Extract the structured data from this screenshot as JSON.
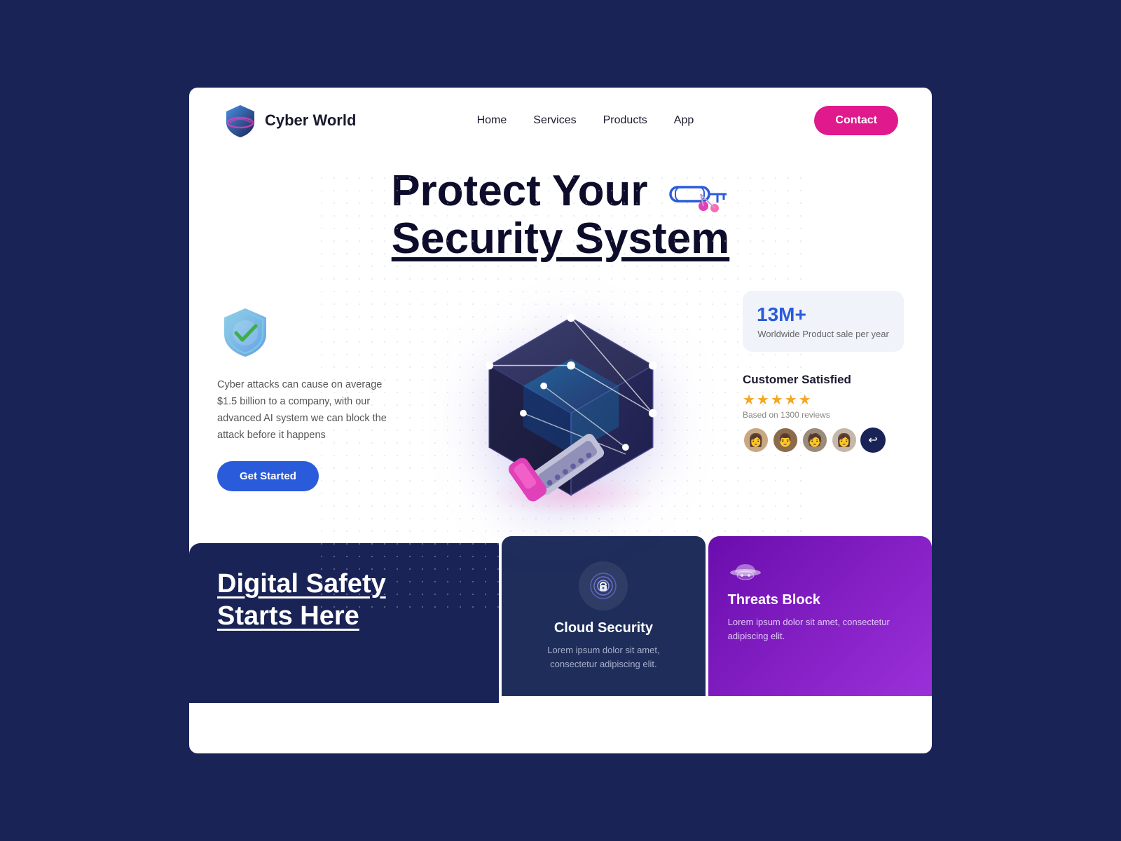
{
  "brand": {
    "name": "Cyber World"
  },
  "nav": {
    "links": [
      "Home",
      "Services",
      "Products",
      "App"
    ],
    "contact_label": "Contact"
  },
  "hero": {
    "line1": "Protect Your",
    "line2": "Security System"
  },
  "left_panel": {
    "body_text": "Cyber attacks can cause on average $1.5 billion to a company, with our advanced AI system we can block the attack before it happens",
    "cta_label": "Get Started"
  },
  "right_panel": {
    "stat_number": "13M+",
    "stat_label": "Worldwide Product sale per year",
    "customers_title": "Customer Satisfied",
    "stars": "★★★★★",
    "reviews_text": "Based on 1300 reviews"
  },
  "bottom": {
    "left_title_line1": "Digital Safety",
    "left_title_line2": "Starts Here",
    "center_title": "Cloud Security",
    "center_body": "Lorem ipsum dolor sit amet, consectetur adipiscing elit.",
    "right_title": "Threats Block",
    "right_body": "Lorem ipsum dolor sit amet, consectetur adipiscing elit."
  }
}
